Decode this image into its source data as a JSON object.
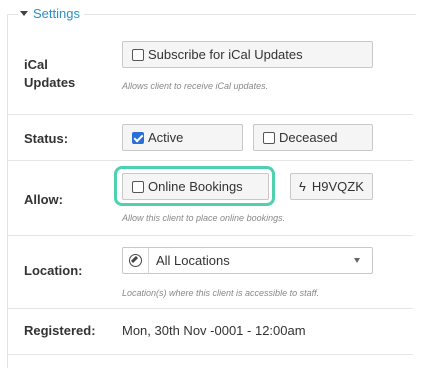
{
  "section": {
    "title": "Settings"
  },
  "ical": {
    "label": "iCal Updates",
    "checkbox_label": "Subscribe for iCal Updates",
    "checked": false,
    "help": "Allows client to receive iCal updates."
  },
  "status": {
    "label": "Status:",
    "active_label": "Active",
    "active_checked": true,
    "deceased_label": "Deceased",
    "deceased_checked": false
  },
  "allow": {
    "label": "Allow:",
    "online_bookings_label": "Online Bookings",
    "online_bookings_checked": false,
    "code": "H9VQZK",
    "help": "Allow this client to place online bookings."
  },
  "location": {
    "label": "Location:",
    "selected": "All Locations",
    "help": "Location(s) where this client is accessible to staff."
  },
  "registered": {
    "label": "Registered:",
    "value": "Mon, 30th Nov -0001 - 12:00am"
  },
  "colors": {
    "accent": "#2a90c8",
    "highlight": "#4fd1b0",
    "checkbox": "#2a6fd8"
  }
}
